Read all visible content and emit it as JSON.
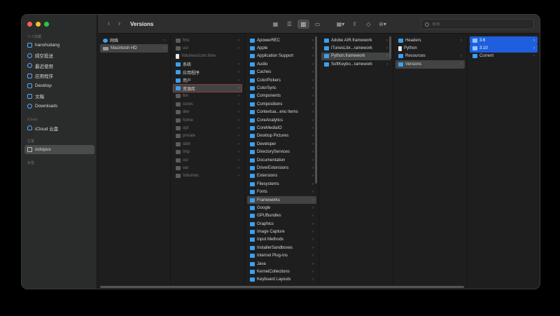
{
  "toolbar": {
    "title": "Versions",
    "back": "‹",
    "forward": "›",
    "icons": {
      "icon_view": "▦",
      "list_view": "☰",
      "column_view": "▥",
      "gallery_view": "▭",
      "group": "▦▾",
      "share": "⇪",
      "tag": "◇",
      "action": "⊖▾"
    },
    "search_placeholder": "搜索"
  },
  "sidebar": {
    "favorites_label": "个人收藏",
    "favorites": [
      {
        "label": "hanshuliang",
        "icon": "home-icon"
      },
      {
        "label": "隔空投送",
        "icon": "airdrop-icon"
      },
      {
        "label": "最近使用",
        "icon": "clock-icon"
      },
      {
        "label": "应用程序",
        "icon": "apps-icon"
      },
      {
        "label": "Desktop",
        "icon": "desktop-icon"
      },
      {
        "label": "文稿",
        "icon": "document-icon"
      },
      {
        "label": "Downloads",
        "icon": "download-icon"
      }
    ],
    "icloud_label": "iCloud",
    "icloud": [
      {
        "label": "iCloud 云盘",
        "icon": "cloud-icon"
      }
    ],
    "locations_label": "位置",
    "locations": [
      {
        "label": "octopus",
        "icon": "laptop-icon"
      }
    ],
    "tags_label": "标签"
  },
  "columns": [
    {
      "items": [
        {
          "label": "网络",
          "icon": "net",
          "state": ""
        },
        {
          "label": "Macintosh HD",
          "icon": "disk",
          "state": "sel"
        }
      ]
    },
    {
      "items": [
        {
          "label": "fmz",
          "dim": true,
          "icon": "folder"
        },
        {
          "label": "usr",
          "dim": true,
          "icon": "folder"
        },
        {
          "label": "Volumes/com.time",
          "dim": true,
          "icon": "file"
        },
        {
          "label": "系统",
          "icon": "folder"
        },
        {
          "label": "应用程序",
          "icon": "folder"
        },
        {
          "label": "用户",
          "icon": "folder"
        },
        {
          "label": "资源库",
          "icon": "folder",
          "state": "sel-red"
        },
        {
          "label": "bin",
          "dim": true,
          "icon": "folder"
        },
        {
          "label": "cores",
          "dim": true,
          "icon": "folder"
        },
        {
          "label": "dev",
          "dim": true,
          "icon": "folder"
        },
        {
          "label": "home",
          "dim": true,
          "icon": "folder"
        },
        {
          "label": "opt",
          "dim": true,
          "icon": "folder"
        },
        {
          "label": "private",
          "dim": true,
          "icon": "folder"
        },
        {
          "label": "sbin",
          "dim": true,
          "icon": "folder"
        },
        {
          "label": "tmp",
          "dim": true,
          "icon": "folder"
        },
        {
          "label": "usr",
          "dim": true,
          "icon": "folder"
        },
        {
          "label": "var",
          "dim": true,
          "icon": "folder"
        },
        {
          "label": "Volumes",
          "dim": true,
          "icon": "folder"
        }
      ]
    },
    {
      "items": [
        {
          "label": "ApowerREC"
        },
        {
          "label": "Apple"
        },
        {
          "label": "Application Support"
        },
        {
          "label": "Audio"
        },
        {
          "label": "Caches"
        },
        {
          "label": "ColorPickers"
        },
        {
          "label": "ColorSync"
        },
        {
          "label": "Components"
        },
        {
          "label": "Compositions"
        },
        {
          "label": "Contextua...enu Items"
        },
        {
          "label": "CoreAnalytics"
        },
        {
          "label": "CoreMediaIO"
        },
        {
          "label": "Desktop Pictures"
        },
        {
          "label": "Developer"
        },
        {
          "label": "DirectoryServices"
        },
        {
          "label": "Documentation"
        },
        {
          "label": "DriverExtensions"
        },
        {
          "label": "Extensions"
        },
        {
          "label": "Filesystems"
        },
        {
          "label": "Fonts"
        },
        {
          "label": "Frameworks",
          "state": "sel"
        },
        {
          "label": "Google"
        },
        {
          "label": "GPUBundles"
        },
        {
          "label": "Graphics"
        },
        {
          "label": "Image Capture"
        },
        {
          "label": "Input Methods"
        },
        {
          "label": "InstallerSandboxes"
        },
        {
          "label": "Internet Plug-Ins"
        },
        {
          "label": "Java"
        },
        {
          "label": "KernelCollections"
        },
        {
          "label": "Keyboard Layouts"
        }
      ]
    },
    {
      "items": [
        {
          "label": "Adobe AIR.framework"
        },
        {
          "label": "iTunesLibr...ramework"
        },
        {
          "label": "Python.framework",
          "state": "sel"
        },
        {
          "label": "SoftKeybo...ramework"
        }
      ]
    },
    {
      "items": [
        {
          "label": "Headers"
        },
        {
          "label": "Python",
          "icon": "file"
        },
        {
          "label": "Resources"
        },
        {
          "label": "Versions",
          "state": "sel"
        }
      ]
    },
    {
      "items": [
        {
          "label": "3.6",
          "state": "sel-blue"
        },
        {
          "label": "3.10",
          "state": "sel-blue"
        },
        {
          "label": "Current"
        }
      ]
    }
  ]
}
